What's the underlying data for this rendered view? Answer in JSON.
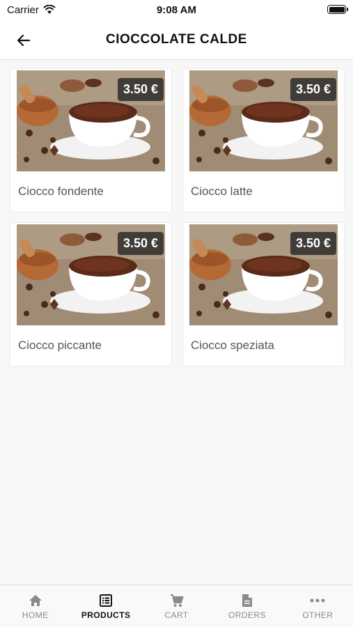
{
  "status_bar": {
    "carrier": "Carrier",
    "time": "9:08 AM"
  },
  "header": {
    "title": "CIOCCOLATE CALDE"
  },
  "products": [
    {
      "name": "Ciocco fondente",
      "price": "3.50 €"
    },
    {
      "name": "Ciocco latte",
      "price": "3.50 €"
    },
    {
      "name": "Ciocco piccante",
      "price": "3.50 €"
    },
    {
      "name": "Ciocco speziata",
      "price": "3.50 €"
    }
  ],
  "tabbar": {
    "active": "products",
    "items": [
      {
        "label": "HOME",
        "icon": "home-icon"
      },
      {
        "label": "PRODUCTS",
        "icon": "list-icon"
      },
      {
        "label": "CART",
        "icon": "cart-icon"
      },
      {
        "label": "ORDERS",
        "icon": "document-icon"
      },
      {
        "label": "OTHER",
        "icon": "more-icon"
      }
    ]
  },
  "colors": {
    "accent": "#111111",
    "inactive": "#8a8a8a",
    "badge": "#282828"
  }
}
